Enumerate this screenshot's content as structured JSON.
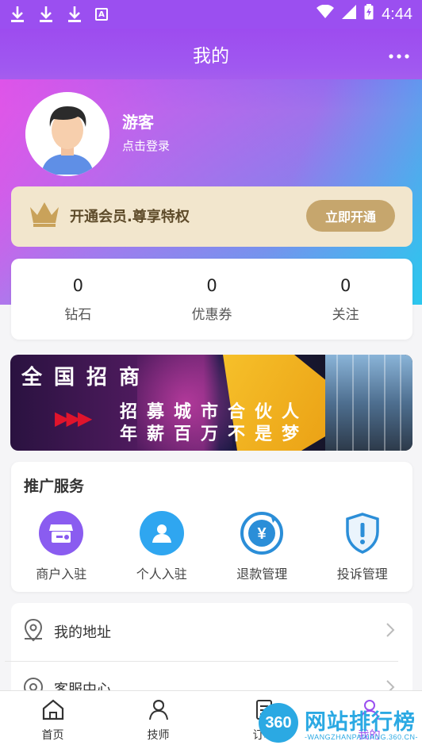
{
  "status_bar": {
    "time": "4:44"
  },
  "header": {
    "title": "我的",
    "more_icon": "more-dots-icon"
  },
  "user": {
    "name": "游客",
    "login_hint": "点击登录"
  },
  "vip": {
    "text": "开通会员.尊享特权",
    "button": "立即开通"
  },
  "stats": [
    {
      "value": "0",
      "label": "钻石"
    },
    {
      "value": "0",
      "label": "优惠券"
    },
    {
      "value": "0",
      "label": "关注"
    }
  ],
  "banner": {
    "title": "全国招商",
    "line1": "招募城市合伙人",
    "line2": "年薪百万不是梦"
  },
  "promo": {
    "title": "推广服务",
    "items": [
      {
        "label": "商户入驻",
        "icon": "store-icon",
        "color": "#8a5cf0"
      },
      {
        "label": "个人入驻",
        "icon": "person-icon",
        "color": "#2fa6f0"
      },
      {
        "label": "退款管理",
        "icon": "refund-icon",
        "color": "#2b8ed8"
      },
      {
        "label": "投诉管理",
        "icon": "complaint-shield-icon",
        "color": "#2b8ed8"
      }
    ]
  },
  "menu": [
    {
      "label": "我的地址",
      "icon": "location-icon"
    },
    {
      "label": "客服中心",
      "icon": "headset-icon"
    }
  ],
  "tabs": [
    {
      "label": "首页",
      "icon": "home-icon"
    },
    {
      "label": "技师",
      "icon": "technician-icon"
    },
    {
      "label": "订单",
      "icon": "order-icon"
    },
    {
      "label": "我的",
      "icon": "user-icon"
    }
  ],
  "watermark": {
    "logo": "360",
    "text": "网站排行榜",
    "sub": "-WANGZHANPAIHANG.360.CN-"
  },
  "colors": {
    "accent": "#9b4ff0",
    "gold": "#c6a66d",
    "vip_bg": "#f2e6cd"
  }
}
